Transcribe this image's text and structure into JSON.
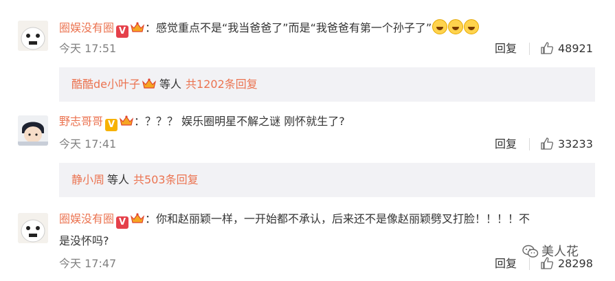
{
  "comments": [
    {
      "username": "圈娱没有圈",
      "text": "：感觉重点不是“我当爸爸了”而是“我爸爸有第一个孙子了”",
      "emoji_count": 3,
      "time": "今天 17:51",
      "reply_label": "回复",
      "likes": "48921",
      "sub": {
        "who": "酷酷de小叶子",
        "etc": "等人",
        "total": "共1202条回复"
      }
    },
    {
      "username": "野志哥哥",
      "text": "：？？？ 娱乐圈明星不解之谜 刚怀就生了?",
      "time": "今天 17:41",
      "reply_label": "回复",
      "likes": "33233",
      "sub": {
        "who": "静小周",
        "etc": "等人",
        "total": "共503条回复"
      }
    },
    {
      "username": "圈娱没有圈",
      "text": "：你和赵丽颖一样，一开始都不承认，后来还不是像赵丽颖劈叉打脸！！！！不",
      "text2": "是没怀吗?",
      "time": "今天 17:47",
      "reply_label": "回复",
      "likes": "28298"
    }
  ],
  "watermark": "美人花",
  "colors": {
    "username": "#eb7350",
    "meta": "#808080",
    "subbox": "#f2f2f5"
  }
}
